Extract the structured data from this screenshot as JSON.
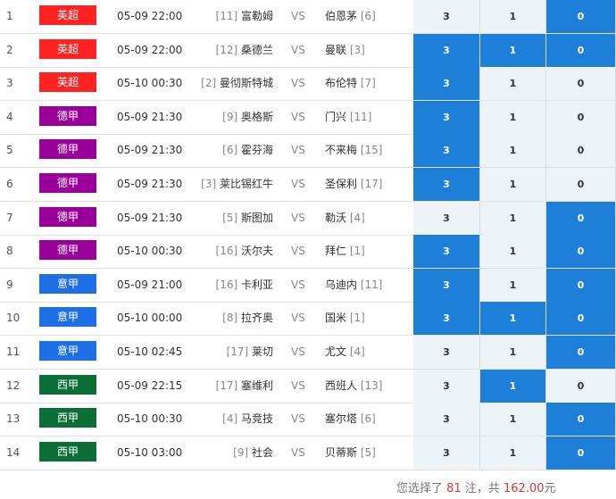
{
  "matches": [
    {
      "num": "1",
      "league": "英超",
      "color": "#ff2222",
      "time": "05-09 22:00",
      "home_rank": "[11]",
      "home": "富勒姆",
      "vs": "VS",
      "away": "伯恩茅",
      "away_rank": "[6]",
      "opt3": "3",
      "opt1": "1",
      "opt0": "0",
      "sel": [
        false,
        false,
        true
      ]
    },
    {
      "num": "2",
      "league": "英超",
      "color": "#ff2222",
      "time": "05-09 22:00",
      "home_rank": "[12]",
      "home": "桑德兰",
      "vs": "VS",
      "away": "曼联",
      "away_rank": "[3]",
      "opt3": "3",
      "opt1": "1",
      "opt0": "0",
      "sel": [
        true,
        true,
        true
      ]
    },
    {
      "num": "3",
      "league": "英超",
      "color": "#ff2222",
      "time": "05-10 00:30",
      "home_rank": "[2]",
      "home": "曼彻斯特城",
      "vs": "VS",
      "away": "布伦特",
      "away_rank": "[7]",
      "opt3": "3",
      "opt1": "1",
      "opt0": "0",
      "sel": [
        true,
        false,
        false
      ]
    },
    {
      "num": "4",
      "league": "德甲",
      "color": "#990099",
      "time": "05-09 21:30",
      "home_rank": "[9]",
      "home": "奥格斯",
      "vs": "VS",
      "away": "门兴",
      "away_rank": "[11]",
      "opt3": "3",
      "opt1": "1",
      "opt0": "0",
      "sel": [
        true,
        false,
        false
      ]
    },
    {
      "num": "5",
      "league": "德甲",
      "color": "#990099",
      "time": "05-09 21:30",
      "home_rank": "[6]",
      "home": "霍芬海",
      "vs": "VS",
      "away": "不来梅",
      "away_rank": "[15]",
      "opt3": "3",
      "opt1": "1",
      "opt0": "0",
      "sel": [
        true,
        false,
        false
      ]
    },
    {
      "num": "6",
      "league": "德甲",
      "color": "#990099",
      "time": "05-09 21:30",
      "home_rank": "[3]",
      "home": "莱比锡红牛",
      "vs": "VS",
      "away": "圣保利",
      "away_rank": "[17]",
      "opt3": "3",
      "opt1": "1",
      "opt0": "0",
      "sel": [
        true,
        false,
        false
      ]
    },
    {
      "num": "7",
      "league": "德甲",
      "color": "#990099",
      "time": "05-09 21:30",
      "home_rank": "[5]",
      "home": "斯图加",
      "vs": "VS",
      "away": "勒沃",
      "away_rank": "[4]",
      "opt3": "3",
      "opt1": "1",
      "opt0": "0",
      "sel": [
        false,
        false,
        true
      ]
    },
    {
      "num": "8",
      "league": "德甲",
      "color": "#990099",
      "time": "05-10 00:30",
      "home_rank": "[16]",
      "home": "沃尔夫",
      "vs": "VS",
      "away": "拜仁",
      "away_rank": "[1]",
      "opt3": "3",
      "opt1": "1",
      "opt0": "0",
      "sel": [
        true,
        false,
        true
      ]
    },
    {
      "num": "9",
      "league": "意甲",
      "color": "#1e6fe6",
      "time": "05-09 21:00",
      "home_rank": "[16]",
      "home": "卡利亚",
      "vs": "VS",
      "away": "乌迪内",
      "away_rank": "[11]",
      "opt3": "3",
      "opt1": "1",
      "opt0": "0",
      "sel": [
        true,
        false,
        true
      ]
    },
    {
      "num": "10",
      "league": "意甲",
      "color": "#1e6fe6",
      "time": "05-10 00:00",
      "home_rank": "[8]",
      "home": "拉齐奥",
      "vs": "VS",
      "away": "国米",
      "away_rank": "[1]",
      "opt3": "3",
      "opt1": "1",
      "opt0": "0",
      "sel": [
        true,
        true,
        true
      ]
    },
    {
      "num": "11",
      "league": "意甲",
      "color": "#1e6fe6",
      "time": "05-10 02:45",
      "home_rank": "[17]",
      "home": "莱切",
      "vs": "VS",
      "away": "尤文",
      "away_rank": "[4]",
      "opt3": "3",
      "opt1": "1",
      "opt0": "0",
      "sel": [
        false,
        false,
        true
      ]
    },
    {
      "num": "12",
      "league": "西甲",
      "color": "#0b6e36",
      "time": "05-09 22:15",
      "home_rank": "[17]",
      "home": "塞维利",
      "vs": "VS",
      "away": "西班人",
      "away_rank": "[13]",
      "opt3": "3",
      "opt1": "1",
      "opt0": "0",
      "sel": [
        false,
        true,
        false
      ]
    },
    {
      "num": "13",
      "league": "西甲",
      "color": "#0b6e36",
      "time": "05-10 00:30",
      "home_rank": "[4]",
      "home": "马竞技",
      "vs": "VS",
      "away": "塞尔塔",
      "away_rank": "[6]",
      "opt3": "3",
      "opt1": "1",
      "opt0": "0",
      "sel": [
        false,
        false,
        true
      ]
    },
    {
      "num": "14",
      "league": "西甲",
      "color": "#0b6e36",
      "time": "05-10 03:00",
      "home_rank": "[9]",
      "home": "社会",
      "vs": "VS",
      "away": "贝蒂斯",
      "away_rank": "[5]",
      "opt3": "3",
      "opt1": "1",
      "opt0": "0",
      "sel": [
        false,
        false,
        true
      ]
    }
  ],
  "footer": {
    "prefix": "您选择了",
    "count": "81",
    "mid": "注，共",
    "amount": "162.00",
    "suffix": "元"
  }
}
